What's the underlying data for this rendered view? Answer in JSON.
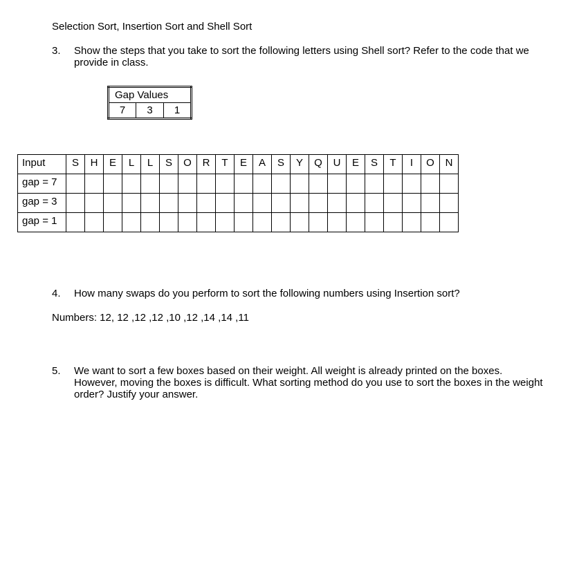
{
  "title": "Selection Sort, Insertion Sort and Shell Sort",
  "q3": {
    "num": "3.",
    "text": "Show the steps that you take to sort the following letters using Shell sort? Refer to the code that we provide in class."
  },
  "gapValues": {
    "header": "Gap Values",
    "values": [
      "7",
      "3",
      "1"
    ]
  },
  "shellTable": {
    "rows": [
      {
        "label": "Input",
        "letters": [
          "S",
          "H",
          "E",
          "L",
          "L",
          "S",
          "O",
          "R",
          "T",
          "E",
          "A",
          "S",
          "Y",
          "Q",
          "U",
          "E",
          "S",
          "T",
          "I",
          "O",
          "N"
        ]
      },
      {
        "label": "gap = 7",
        "letters": [
          "",
          "",
          "",
          "",
          "",
          "",
          "",
          "",
          "",
          "",
          "",
          "",
          "",
          "",
          "",
          "",
          "",
          "",
          "",
          "",
          ""
        ]
      },
      {
        "label": "gap = 3",
        "letters": [
          "",
          "",
          "",
          "",
          "",
          "",
          "",
          "",
          "",
          "",
          "",
          "",
          "",
          "",
          "",
          "",
          "",
          "",
          "",
          "",
          ""
        ]
      },
      {
        "label": "gap = 1",
        "letters": [
          "",
          "",
          "",
          "",
          "",
          "",
          "",
          "",
          "",
          "",
          "",
          "",
          "",
          "",
          "",
          "",
          "",
          "",
          "",
          "",
          ""
        ]
      }
    ]
  },
  "q4": {
    "num": "4.",
    "text": "How many swaps do you perform to sort the following numbers using Insertion sort?",
    "numbers": "Numbers: 12, 12 ,12 ,12 ,10 ,12 ,14 ,14 ,11"
  },
  "q5": {
    "num": "5.",
    "text": "We want to sort a few boxes based on their weight. All weight is already printed on the boxes. However, moving the boxes is difficult. What sorting method do you use to sort the boxes in the weight order? Justify your answer."
  }
}
